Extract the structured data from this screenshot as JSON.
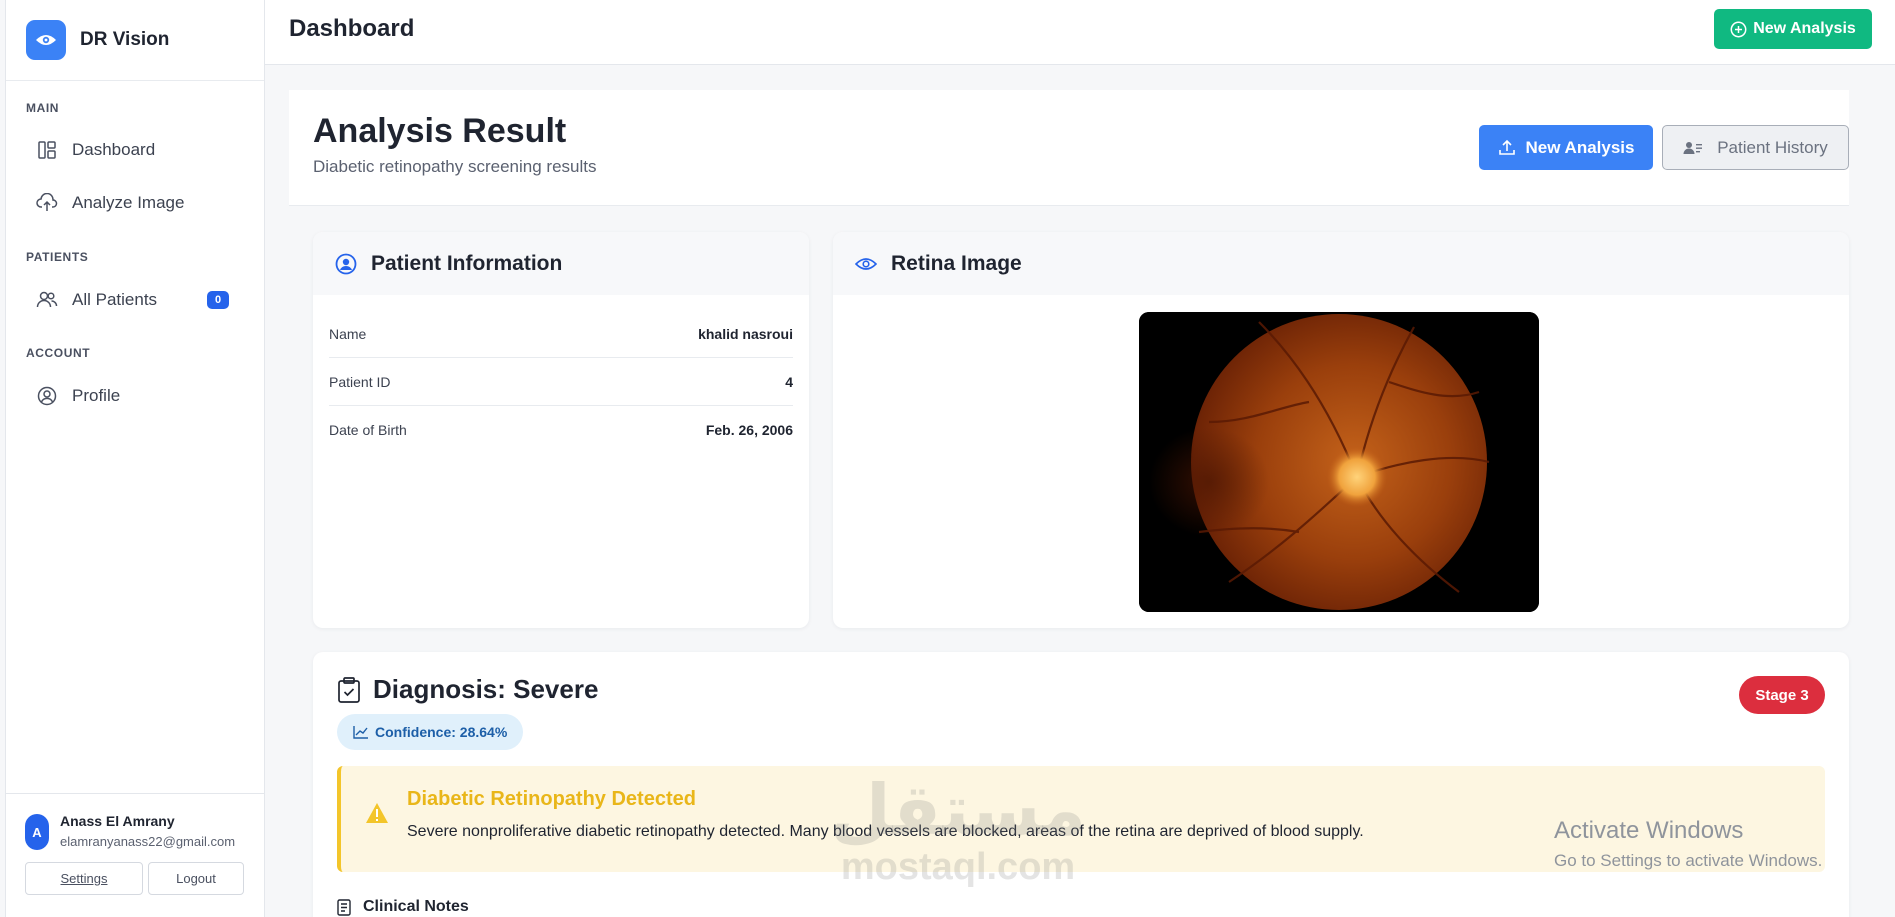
{
  "app": {
    "name": "DR Vision"
  },
  "sidebar": {
    "sections": {
      "main": "MAIN",
      "patients": "PATIENTS",
      "account": "ACCOUNT"
    },
    "items": [
      {
        "label": "Dashboard",
        "icon": "dashboard-icon"
      },
      {
        "label": "Analyze Image",
        "icon": "cloud-upload-icon"
      },
      {
        "label": "All Patients",
        "icon": "users-icon",
        "count": "0"
      },
      {
        "label": "Profile",
        "icon": "user-circle-icon"
      }
    ],
    "user": {
      "initial": "A",
      "name": "Anass El Amrany",
      "email": "elamranyanass22@gmail.com",
      "settings_label": "Settings",
      "logout_label": "Logout"
    }
  },
  "header": {
    "title": "Dashboard",
    "new_analysis_label": "New Analysis"
  },
  "result": {
    "title": "Analysis Result",
    "subtitle": "Diabetic retinopathy screening results",
    "new_analysis_label": "New Analysis",
    "patient_history_label": "Patient History"
  },
  "patient_card": {
    "title": "Patient Information",
    "rows": [
      {
        "label": "Name",
        "value": "khalid nasroui"
      },
      {
        "label": "Patient ID",
        "value": "4"
      },
      {
        "label": "Date of Birth",
        "value": "Feb. 26, 2006"
      }
    ]
  },
  "retina_card": {
    "title": "Retina Image"
  },
  "diagnosis": {
    "title": "Diagnosis: Severe",
    "stage": "Stage 3",
    "confidence": "Confidence: 28.64%",
    "alert_title": "Diabetic Retinopathy Detected",
    "alert_text": "Severe nonproliferative diabetic retinopathy detected. Many blood vessels are blocked, areas of the retina are deprived of blood supply.",
    "notes_title": "Clinical Notes"
  },
  "overlay": {
    "watermark_ar": "مستقل",
    "watermark_en": "mostaql.com",
    "activate_title": "Activate Windows",
    "activate_sub": "Go to Settings to activate Windows."
  },
  "colors": {
    "primary": "#3b82f6",
    "success": "#10b981",
    "danger": "#dc2e3e",
    "warning": "#f3c52a"
  }
}
